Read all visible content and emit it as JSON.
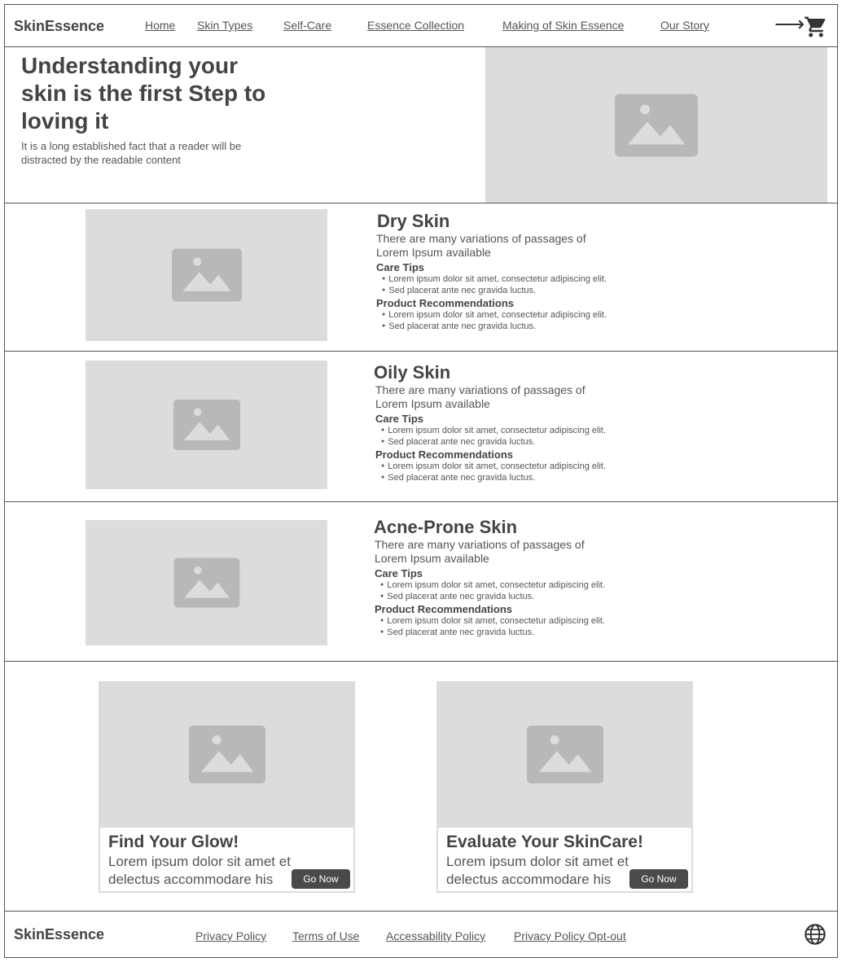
{
  "header": {
    "brand": "SkinEssence",
    "nav": [
      "Home",
      "Skin Types",
      "Self-Care",
      "Essence Collection",
      "Making of Skin Essence",
      "Our Story"
    ],
    "arrow_icon": "arrow-right-icon",
    "cart_icon": "cart-icon"
  },
  "hero": {
    "title": "Understanding your skin is the first Step to loving it",
    "description": "It is a long established fact that a reader will be distracted by the readable content",
    "image_icon": "image-placeholder-icon"
  },
  "skin_types": [
    {
      "title": "Dry Skin",
      "description": "There are many variations of passages of Lorem Ipsum available",
      "care_tips_label": "Care Tips",
      "care_tips": [
        "Lorem ipsum dolor sit amet, consectetur adipiscing elit.",
        "Sed placerat ante nec gravida luctus."
      ],
      "products_label": "Product Recommendations",
      "products": [
        "Lorem ipsum dolor sit amet, consectetur adipiscing elit.",
        "Sed placerat ante nec gravida luctus."
      ]
    },
    {
      "title": "Oily Skin",
      "description": "There are many variations of passages of Lorem Ipsum available",
      "care_tips_label": "Care Tips",
      "care_tips": [
        "Lorem ipsum dolor sit amet, consectetur adipiscing elit.",
        "Sed placerat ante nec gravida luctus."
      ],
      "products_label": "Product Recommendations",
      "products": [
        "Lorem ipsum dolor sit amet, consectetur adipiscing elit.",
        "Sed placerat ante nec gravida luctus."
      ]
    },
    {
      "title": "Acne-Prone Skin",
      "description": "There are many variations of passages of Lorem Ipsum available",
      "care_tips_label": "Care Tips",
      "care_tips": [
        "Lorem ipsum dolor sit amet, consectetur adipiscing elit.",
        "Sed placerat ante nec gravida luctus."
      ],
      "products_label": "Product Recommendations",
      "products": [
        "Lorem ipsum dolor sit amet, consectetur adipiscing elit.",
        "Sed placerat ante nec gravida luctus."
      ]
    }
  ],
  "cards": [
    {
      "title": "Find Your Glow!",
      "text": "Lorem ipsum dolor sit amet et delectus accommodare his",
      "button": "Go Now"
    },
    {
      "title": "Evaluate Your SkinCare!",
      "text": "Lorem ipsum dolor sit amet et delectus accommodare his",
      "button": "Go Now"
    }
  ],
  "footer": {
    "brand": "SkinEssence",
    "links": [
      "Privacy Policy",
      "Terms of Use",
      "Accessability Policy",
      "Privacy Policy Opt-out"
    ],
    "globe_icon": "globe-icon"
  },
  "colors": {
    "text": "#444444",
    "placeholder": "#dcdcdc",
    "placeholder_icon": "#b8b8b8",
    "button": "#4a4a4a",
    "border": "#555555"
  }
}
